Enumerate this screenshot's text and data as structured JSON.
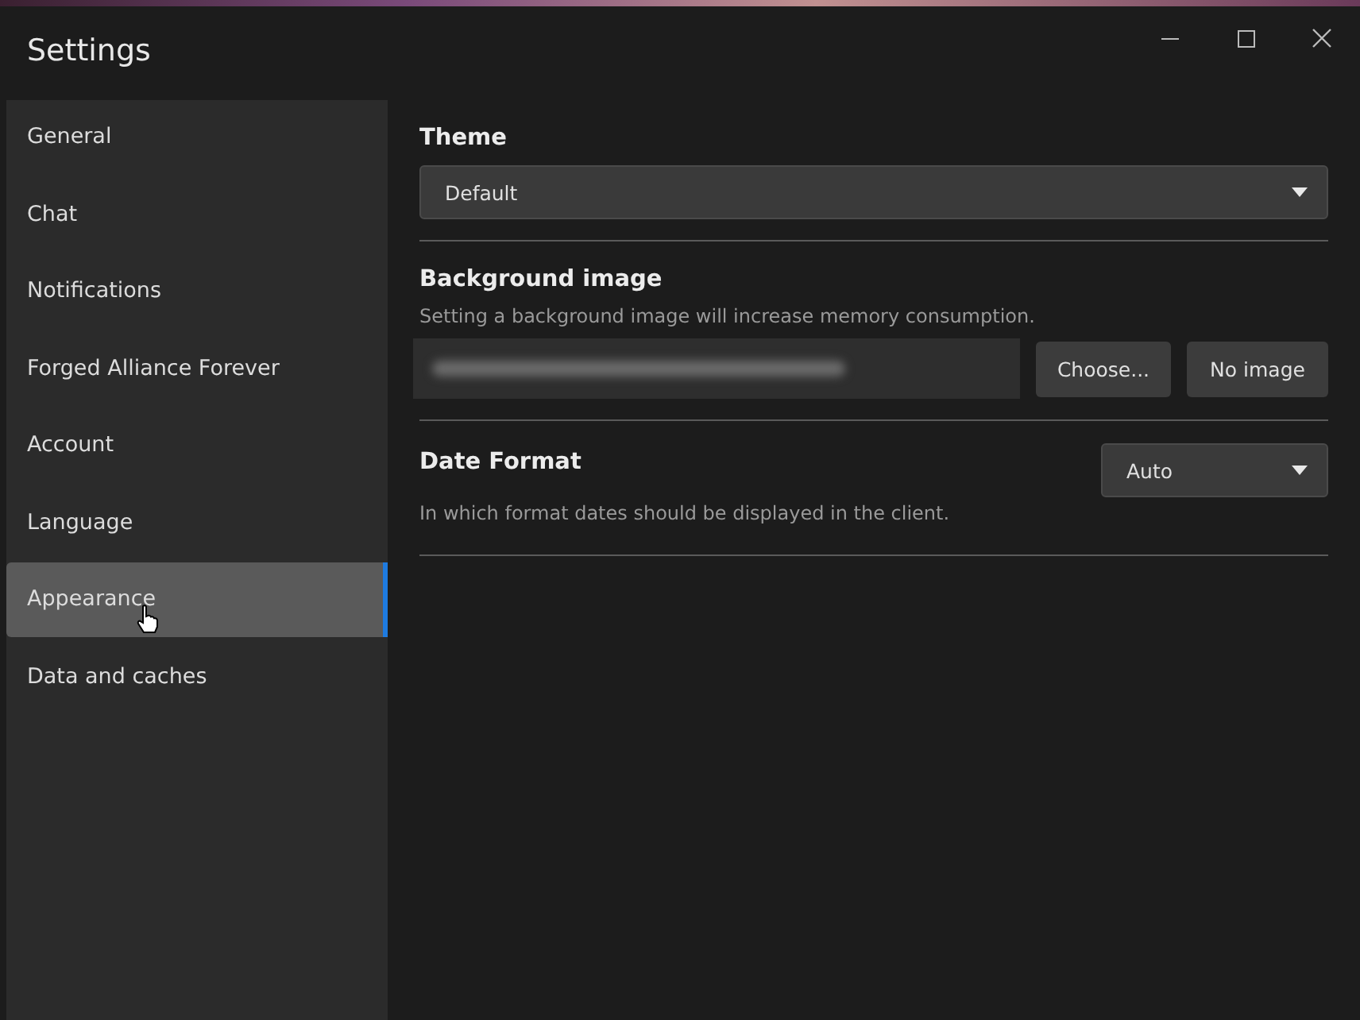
{
  "window": {
    "title": "Settings"
  },
  "sidebar": {
    "items": [
      {
        "label": "General",
        "selected": false
      },
      {
        "label": "Chat",
        "selected": false
      },
      {
        "label": "Notifications",
        "selected": false
      },
      {
        "label": "Forged Alliance Forever",
        "selected": false
      },
      {
        "label": "Account",
        "selected": false
      },
      {
        "label": "Language",
        "selected": false
      },
      {
        "label": "Appearance",
        "selected": true
      },
      {
        "label": "Data and caches",
        "selected": false
      }
    ]
  },
  "sections": [
    {
      "kind": "dropdown",
      "title": "Theme",
      "value": "Default"
    },
    {
      "kind": "file",
      "title": "Background image",
      "description": "Setting a background image will increase memory consumption.",
      "buttons": [
        "Choose...",
        "No image"
      ]
    },
    {
      "kind": "inline-dropdown",
      "title": "Date Format",
      "description": "In which format dates should be displayed in the client.",
      "value": "Auto"
    }
  ]
}
